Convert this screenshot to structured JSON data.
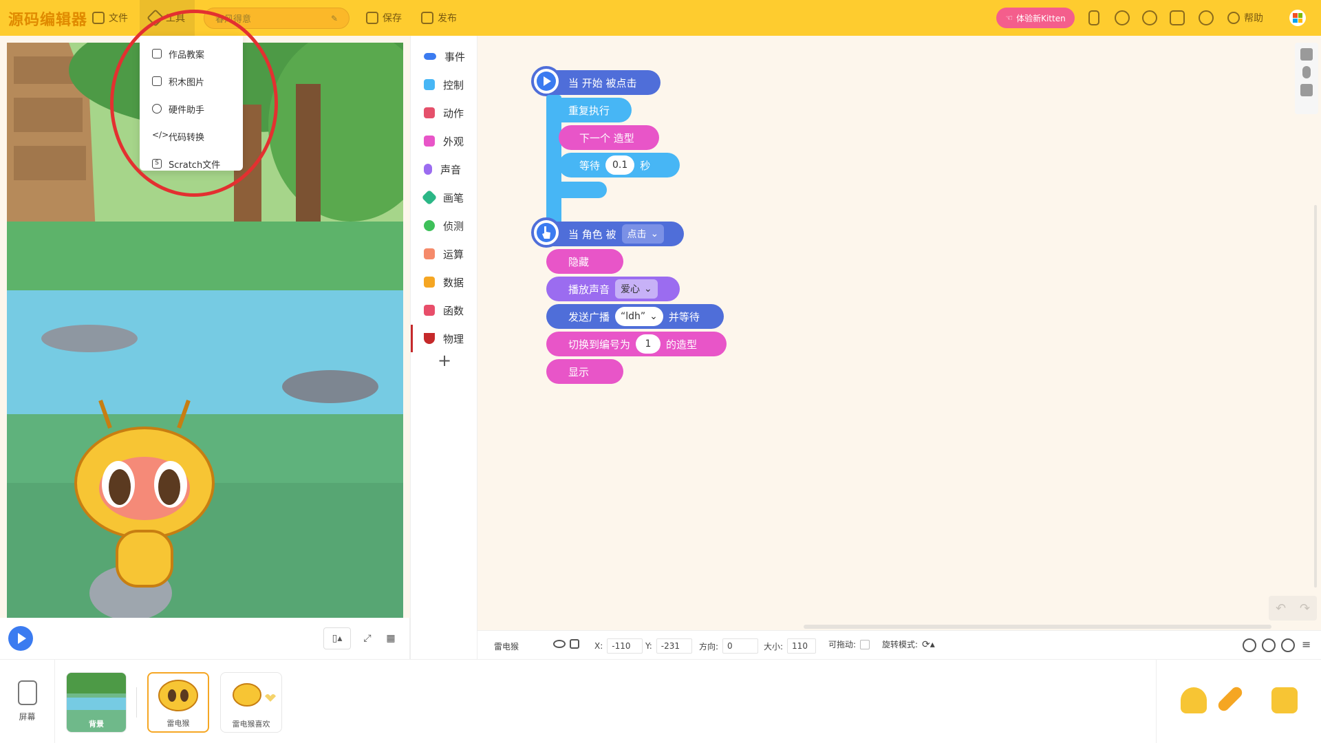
{
  "app": {
    "logo": "源码编辑器",
    "menu": {
      "file": "文件",
      "tools": "工具",
      "save": "保存",
      "publish": "发布"
    },
    "project_name": "春风得意",
    "kitten_button": "体验新Kitten",
    "help": "帮助"
  },
  "tools_dropdown": {
    "items": [
      {
        "label": "作品教案",
        "icon": "printer-icon"
      },
      {
        "label": "积木图片",
        "icon": "image-icon"
      },
      {
        "label": "硬件助手",
        "icon": "robot-eye-icon"
      },
      {
        "label": "代码转换",
        "icon": "code-icon"
      },
      {
        "label": "Scratch文件",
        "icon": "scratch-s-icon"
      }
    ]
  },
  "palette": {
    "categories": [
      {
        "label": "事件",
        "color": "#3b7bf0"
      },
      {
        "label": "控制",
        "color": "#47b6f5"
      },
      {
        "label": "动作",
        "color": "#e5506b"
      },
      {
        "label": "外观",
        "color": "#e855c8"
      },
      {
        "label": "声音",
        "color": "#9b6cf0"
      },
      {
        "label": "画笔",
        "color": "#2bb786"
      },
      {
        "label": "侦测",
        "color": "#3ec05a"
      },
      {
        "label": "运算",
        "color": "#f58a6a"
      },
      {
        "label": "数据",
        "color": "#f5a623"
      },
      {
        "label": "函数",
        "color": "#e84e6a"
      },
      {
        "label": "物理",
        "color": "#c5292a"
      }
    ],
    "add": "+"
  },
  "scripts": {
    "script1": {
      "hat": "当 开始 被点击",
      "repeat": "重复执行",
      "next_costume": "下一个 造型",
      "wait_label": "等待",
      "wait_value": "0.1",
      "wait_unit": "秒"
    },
    "script2": {
      "hat_prefix": "当 角色 被",
      "hat_option": "点击",
      "hide": "隐藏",
      "play_sound": "播放声音",
      "sound_option": "爱心",
      "broadcast": "发送广播",
      "broadcast_option": "“ldh”",
      "broadcast_suffix": "并等待",
      "switch_prefix": "切换到编号为",
      "switch_value": "1",
      "switch_suffix": "的造型",
      "show": "显示"
    }
  },
  "status_bar": {
    "sprite_name": "雷电猴",
    "x_label": "X:",
    "x_value": "-110",
    "y_label": "Y:",
    "y_value": "-231",
    "direction_label": "方向:",
    "direction_value": "0",
    "size_label": "大小:",
    "size_value": "110",
    "draggable_label": "可拖动:",
    "rotation_label": "旋转模式:"
  },
  "sprites": {
    "screen_label": "屏幕",
    "items": [
      {
        "label": "背景"
      },
      {
        "label": "雷电猴"
      },
      {
        "label": "雷电猴喜欢"
      }
    ]
  },
  "colors": {
    "topbar": "#fecc2f",
    "event_block": "#4f6ed9",
    "control_block": "#47b6f5",
    "looks_block": "#e855c8",
    "sound_block": "#9b6cf0",
    "kitten_button": "#f45e8c",
    "annotation_circle": "#e33030"
  }
}
